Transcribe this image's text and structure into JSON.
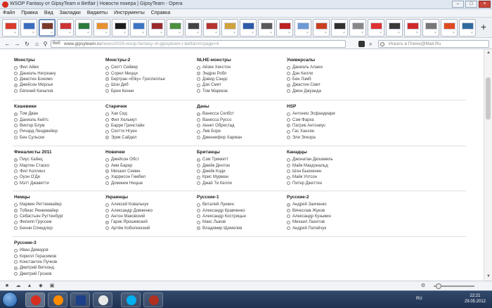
{
  "window": {
    "title": "WSOP Fantasy от GipsyTeam и Betfair | Новости покера | GipsyTeam - Opera",
    "buttons": [
      "–",
      "□",
      "×"
    ]
  },
  "menu": [
    "Файл",
    "Правка",
    "Вид",
    "Закладки",
    "Виджеты",
    "Инструменты",
    "Справка"
  ],
  "speed_dial": {
    "tab_count": 26,
    "active_index": 2,
    "new_tab": "+"
  },
  "address": {
    "badge": "Веб",
    "url_host": "www.gipsyteam.ru",
    "url_path": "/news/2026-wsop-fantasy-ot-gipsyteam-i-betfair#/cpage=4",
    "search_placeholder": "Искать в Поиск@Mail.Ru"
  },
  "groups": [
    {
      "title": "Монстры",
      "items": [
        {
          "name": "Фил Айви",
          "on": false
        },
        {
          "name": "Даниэль Негреану",
          "on": false
        },
        {
          "name": "Джастин Бономо",
          "on": false
        },
        {
          "name": "Джейсон Мерсье",
          "on": true
        },
        {
          "name": "Евгений Качалов",
          "on": false
        }
      ]
    },
    {
      "title": "Монстры-2",
      "items": [
        {
          "name": "Скотт Сейвер",
          "on": false
        },
        {
          "name": "Сорел Мицци",
          "on": false
        },
        {
          "name": "Бертран «Elky» Гроспеллье",
          "on": true
        },
        {
          "name": "Шон Диб",
          "on": false
        },
        {
          "name": "Брин Кенни",
          "on": false
        }
      ]
    },
    {
      "title": "NLHE-монстры",
      "items": [
        {
          "name": "Айзек Хекстон",
          "on": false
        },
        {
          "name": "Эндрю Робл",
          "on": true
        },
        {
          "name": "Дэвид Сэндс",
          "on": false
        },
        {
          "name": "Дэн Смит",
          "on": false
        },
        {
          "name": "Том Маркезе",
          "on": false
        }
      ]
    },
    {
      "title": "Универсалы",
      "items": [
        {
          "name": "Даниэль Алаеи",
          "on": false
        },
        {
          "name": "Дэн Келли",
          "on": false
        },
        {
          "name": "Бен Лэмб",
          "on": false
        },
        {
          "name": "Джастин Смит",
          "on": true
        },
        {
          "name": "Джон Джуанда",
          "on": false
        }
      ]
    },
    {
      "title": "Кэшевики",
      "items": [
        {
          "name": "Том Дван",
          "on": true
        },
        {
          "name": "Даниэль Кейтс",
          "on": false
        },
        {
          "name": "Виктор Блум",
          "on": false
        },
        {
          "name": "Ричард Линдмейер",
          "on": false
        },
        {
          "name": "Бен Сульски",
          "on": false
        }
      ]
    },
    {
      "title": "Старички",
      "items": [
        {
          "name": "Хак Сид",
          "on": false
        },
        {
          "name": "Фил Хельмут",
          "on": false
        },
        {
          "name": "Барри Гринстайн",
          "on": false
        },
        {
          "name": "Скотти Нгуен",
          "on": false
        },
        {
          "name": "Эрик Сайдел",
          "on": true
        }
      ]
    },
    {
      "title": "Даны",
      "items": [
        {
          "name": "Ванесса Селбст",
          "on": true
        },
        {
          "name": "Ванесса Руссо",
          "on": false
        },
        {
          "name": "Аннет Обрестад",
          "on": false
        },
        {
          "name": "Лив Боре",
          "on": false
        },
        {
          "name": "Дженнифер Харман",
          "on": false
        }
      ]
    },
    {
      "title": "HSP",
      "items": [
        {
          "name": "Антонио Эсфандиари",
          "on": false
        },
        {
          "name": "Сэм Фарха",
          "on": false
        },
        {
          "name": "Патрик Антониус",
          "on": true
        },
        {
          "name": "Гас Хансен",
          "on": false
        },
        {
          "name": "Эли Элезра",
          "on": false
        }
      ]
    },
    {
      "title": "Финалисты 2011",
      "items": [
        {
          "name": "Пиус Хайнц",
          "on": true
        },
        {
          "name": "Мартин Стаско",
          "on": false
        },
        {
          "name": "Фил Коллинз",
          "on": false
        },
        {
          "name": "Оуэн О'Ди",
          "on": false
        },
        {
          "name": "Мэтт Джаветти",
          "on": false
        }
      ]
    },
    {
      "title": "Новички",
      "items": [
        {
          "name": "Джейсон Обст",
          "on": false
        },
        {
          "name": "Ами Барер",
          "on": false
        },
        {
          "name": "Михаил Семин",
          "on": true
        },
        {
          "name": "Харрисон Гимбел",
          "on": false
        },
        {
          "name": "Доминик Ницше",
          "on": false
        }
      ]
    },
    {
      "title": "Британцы",
      "items": [
        {
          "name": "Сэм Триккетт",
          "on": true
        },
        {
          "name": "Джейк Дентон",
          "on": false
        },
        {
          "name": "Джейк Коди",
          "on": false
        },
        {
          "name": "Крис Мурман",
          "on": false
        },
        {
          "name": "Джай Ти Келли",
          "on": false
        }
      ]
    },
    {
      "title": "Канадцы",
      "items": [
        {
          "name": "Джонатан Дюхамель",
          "on": false
        },
        {
          "name": "Майк Макдональд",
          "on": false
        },
        {
          "name": "Шон Бьюкенен",
          "on": false
        },
        {
          "name": "Майк Уотсон",
          "on": false
        },
        {
          "name": "Питер Джеттен",
          "on": false
        }
      ]
    },
    {
      "title": "Немцы",
      "items": [
        {
          "name": "Марвин Реттенмайер",
          "on": false
        },
        {
          "name": "Тобиас Ренкемайер",
          "on": true
        },
        {
          "name": "Себастьян Руттенбург",
          "on": false
        },
        {
          "name": "Филипп Груссем",
          "on": false
        },
        {
          "name": "Бенни Спиндлер",
          "on": false
        }
      ]
    },
    {
      "title": "Украинцы",
      "items": [
        {
          "name": "Алексей Ковальчук",
          "on": false
        },
        {
          "name": "Александр Довженко",
          "on": false
        },
        {
          "name": "Антон Маковский",
          "on": false
        },
        {
          "name": "Гарик Ярошевский",
          "on": true
        },
        {
          "name": "Артём Кобилинский",
          "on": false
        }
      ]
    },
    {
      "title": "Русские-1",
      "items": [
        {
          "name": "Виталий Лункин",
          "on": false
        },
        {
          "name": "Александр Кравченко",
          "on": false
        },
        {
          "name": "Александр Кострицын",
          "on": false
        },
        {
          "name": "Макс Лыков",
          "on": false
        },
        {
          "name": "Владимир Щемелев",
          "on": true
        }
      ]
    },
    {
      "title": "Русские-2",
      "items": [
        {
          "name": "Андрей Заиченко",
          "on": true
        },
        {
          "name": "Вячеслав Жуков",
          "on": false
        },
        {
          "name": "Александр Кузьмин",
          "on": false
        },
        {
          "name": "Михаил Лахитов",
          "on": false
        },
        {
          "name": "Андрей Патейчук",
          "on": false
        }
      ]
    },
    {
      "title": "Русские-3",
      "items": [
        {
          "name": "Иван Демидов",
          "on": false
        },
        {
          "name": "Кирилл Герасимов",
          "on": false
        },
        {
          "name": "Константин Пучков",
          "on": false
        },
        {
          "name": "Дмитрий Витконд",
          "on": true
        },
        {
          "name": "Дмитрий Гронов",
          "on": false
        }
      ]
    }
  ],
  "taskbar": {
    "lang": "RU",
    "time": "22:21",
    "date": "29.05.2012"
  }
}
